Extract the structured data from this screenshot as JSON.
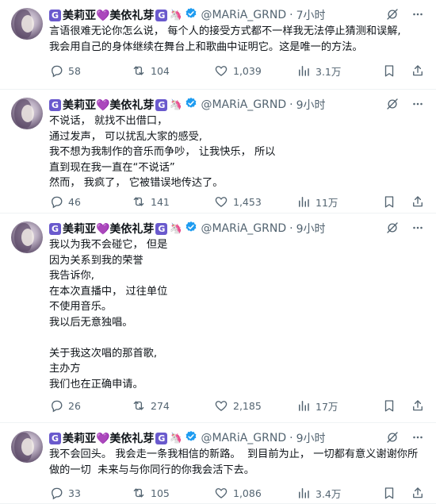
{
  "account": {
    "display_name": "美莉亚💜美依礼芽",
    "handle": "@MARiA_GRND"
  },
  "tweets": [
    {
      "time": "7小时",
      "text": "言语很难无论你怎么说， 每个人的接受方式都不一样我无法停止猜测和误解,\n我会用自己的身体继续在舞台上和歌曲中证明它。这是唯一的方法。",
      "replies": "58",
      "reposts": "104",
      "likes": "1,039",
      "views": "3.1万"
    },
    {
      "time": "9小时",
      "text": "不说话， 就找不出借口，\n通过发声， 可以扰乱大家的感受,\n我不想为我制作的音乐而争吵， 让我快乐， 所以\n直到现在我一直在“不说话”\n然而， 我疯了， 它被错误地传达了。",
      "replies": "46",
      "reposts": "141",
      "likes": "1,453",
      "views": "11万"
    },
    {
      "time": "9小时",
      "text": "我以为我不会碰它， 但是\n因为关系到我的荣誉\n我告诉你,\n在本次直播中， 过往单位\n不使用音乐。\n我以后无意独唱。\n\n关于我这次唱的那首歌,\n主办方\n我们也在正确申请。",
      "replies": "26",
      "reposts": "274",
      "likes": "2,185",
      "views": "17万"
    },
    {
      "time": "9小时",
      "text": "我不会回头。 我会走一条我相信的新路。  到目前为止， 一切都有意义谢谢你所\n做的一切  未来与与你同行的你我会活下去。",
      "replies": "33",
      "reposts": "105",
      "likes": "1,086",
      "views": "3.4万"
    }
  ],
  "icons": {
    "reply": "reply-icon",
    "repost": "repost-icon",
    "like": "heart-icon",
    "views": "views-icon",
    "bookmark": "bookmark-icon",
    "share": "share-icon",
    "grok": "grok-icon",
    "more": "more-icon"
  },
  "colors": {
    "text": "#0f1419",
    "muted": "#536471",
    "verified": "#1d9bf0",
    "divider": "#eff3f4"
  }
}
